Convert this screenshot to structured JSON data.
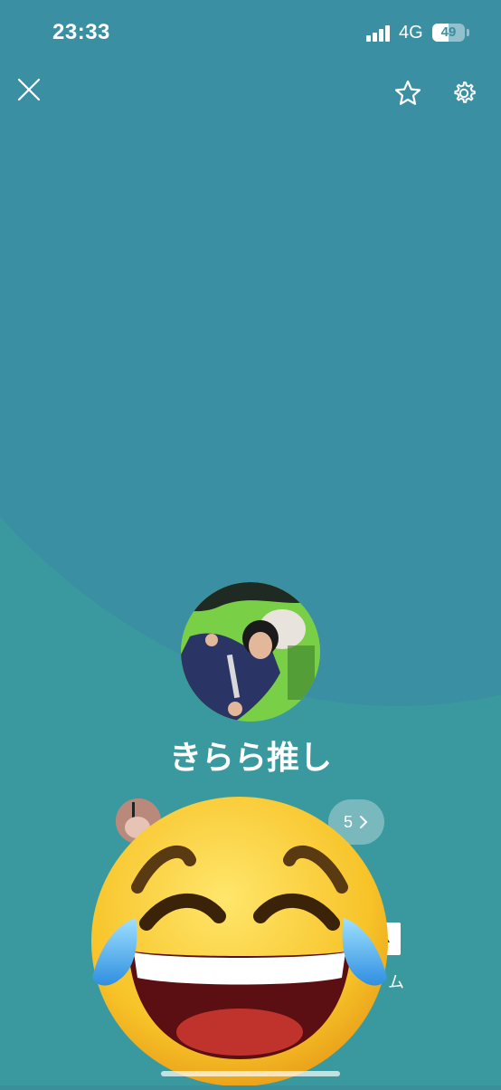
{
  "status_bar": {
    "time": "23:33",
    "network": "4G",
    "battery": "49",
    "battery_level": 0.49
  },
  "toolbar": {
    "close_icon": "close-icon",
    "favorite_icon": "star-icon",
    "settings_icon": "gear-icon"
  },
  "profile": {
    "name": "きらら推し",
    "avatar_icon": "profile-photo"
  },
  "friends_row": {
    "more_count": "5",
    "more_icon": "chevron-right-icon"
  },
  "actions": {
    "album_label": "ム"
  },
  "overlay": {
    "emoji": "face-with-tears-of-joy"
  },
  "colors": {
    "background_top": "#3a8fa3",
    "background_bottom": "#3a999e",
    "text": "#ffffff"
  }
}
